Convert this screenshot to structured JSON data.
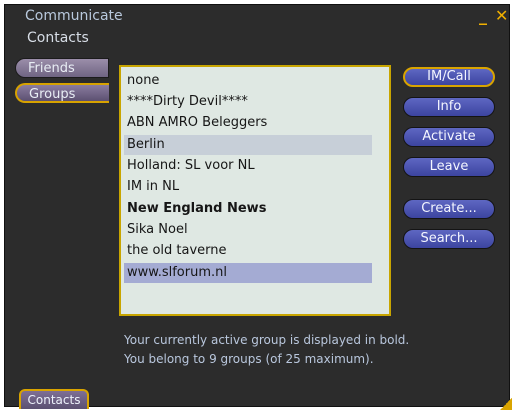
{
  "window": {
    "title": "Communicate",
    "minimize_glyph": "_",
    "close_glyph": "✕"
  },
  "section_heading": "Contacts",
  "tabs": [
    {
      "label": "Friends",
      "active": false
    },
    {
      "label": "Groups",
      "active": true
    }
  ],
  "groups": {
    "items": [
      {
        "name": "none",
        "bold": false,
        "state": "normal"
      },
      {
        "name": "****Dirty Devil****",
        "bold": false,
        "state": "normal"
      },
      {
        "name": "ABN AMRO Beleggers",
        "bold": false,
        "state": "normal"
      },
      {
        "name": "Berlin",
        "bold": false,
        "state": "selected"
      },
      {
        "name": "Holland: SL voor NL",
        "bold": false,
        "state": "normal"
      },
      {
        "name": "IM in NL",
        "bold": false,
        "state": "normal"
      },
      {
        "name": "New England News",
        "bold": true,
        "state": "normal"
      },
      {
        "name": "Sika Noel",
        "bold": false,
        "state": "normal"
      },
      {
        "name": "the old taverne",
        "bold": false,
        "state": "normal"
      },
      {
        "name": "www.slforum.nl",
        "bold": false,
        "state": "highlight"
      }
    ]
  },
  "buttons": {
    "im_call": "IM/Call",
    "info": "Info",
    "activate": "Activate",
    "leave": "Leave",
    "create": "Create...",
    "search": "Search..."
  },
  "status": {
    "line1": "Your currently active group is displayed in bold.",
    "line2": "You belong to 9 groups (of 25 maximum)."
  },
  "bottom_tab": "Contacts",
  "colors": {
    "accent": "#d9a400",
    "window_bg": "#2c2c2c",
    "list_bg": "#dfe8e3",
    "button_bg": "#4b54b3"
  }
}
